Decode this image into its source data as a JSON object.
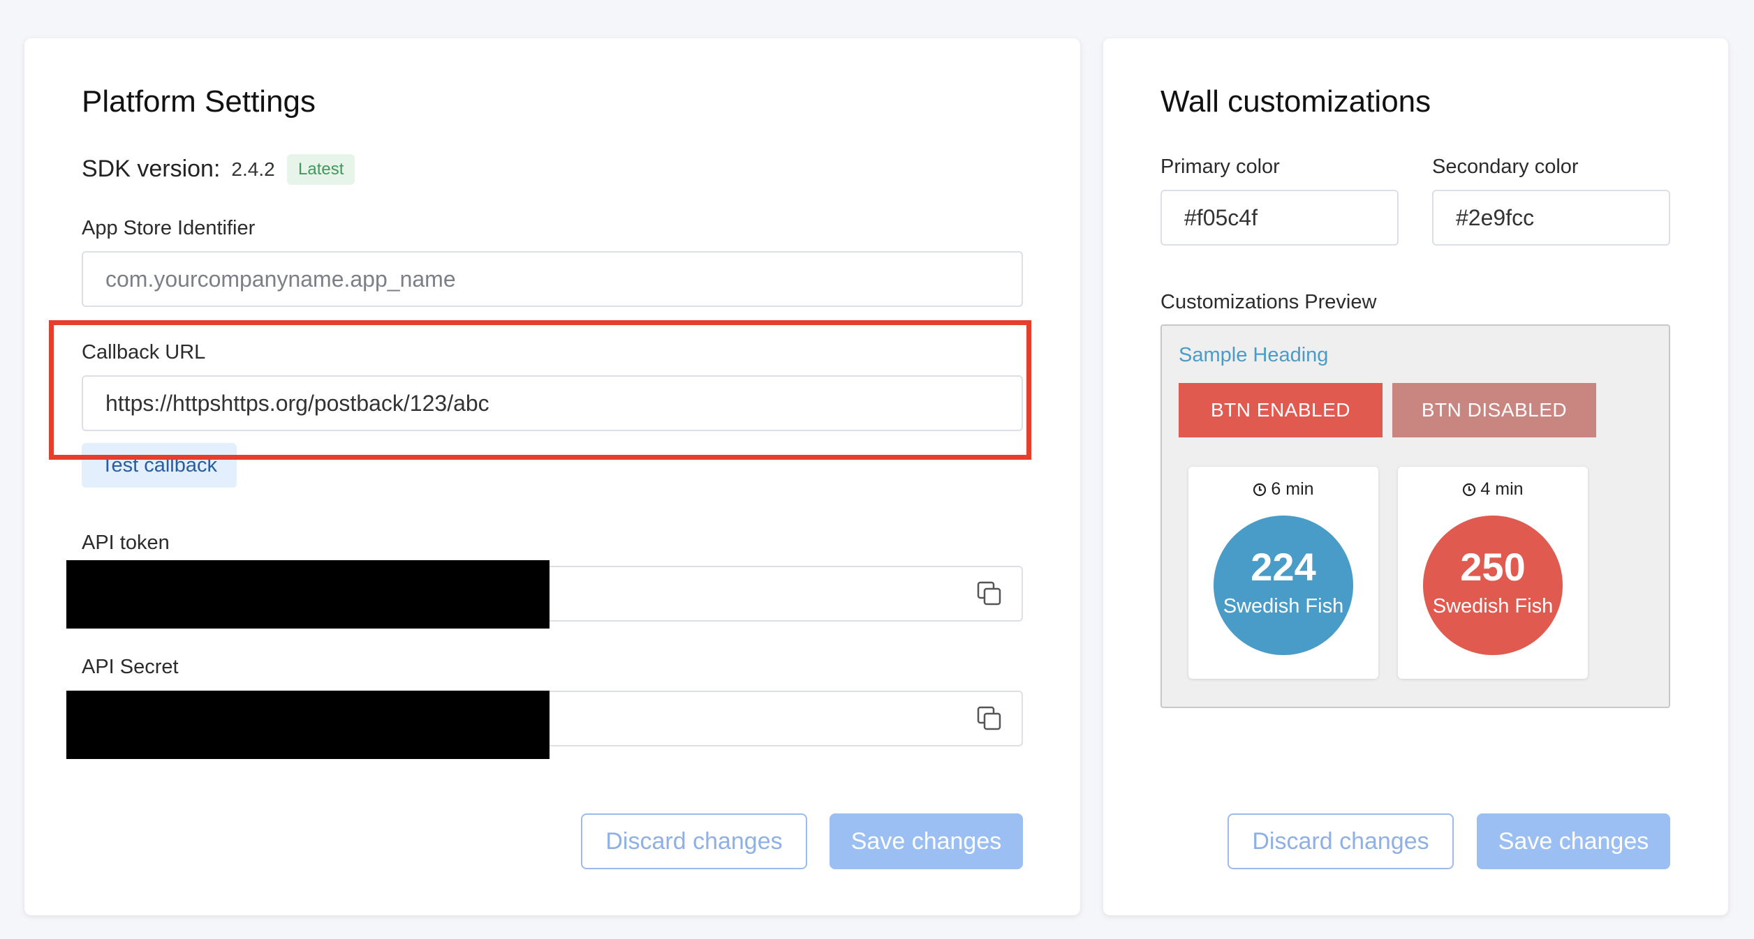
{
  "platform": {
    "title": "Platform Settings",
    "sdk_label": "SDK version:",
    "sdk_version": "2.4.2",
    "sdk_badge": "Latest",
    "app_store_label": "App Store Identifier",
    "app_store_placeholder": "com.yourcompanyname.app_name",
    "callback_label": "Callback URL",
    "callback_value": "https://httpshttps.org/postback/123/abc",
    "test_callback_label": "Test callback",
    "api_token_label": "API token",
    "api_secret_label": "API Secret",
    "discard_label": "Discard changes",
    "save_label": "Save changes"
  },
  "wall": {
    "title": "Wall customizations",
    "primary_label": "Primary color",
    "primary_value": "#f05c4f",
    "secondary_label": "Secondary color",
    "secondary_value": "#2e9fcc",
    "preview_label": "Customizations Preview",
    "preview": {
      "heading": "Sample Heading",
      "btn_enabled": "BTN ENABLED",
      "btn_disabled": "BTN DISABLED",
      "offers": [
        {
          "time": "6 min",
          "amount": "224",
          "currency": "Swedish Fish",
          "color": "#4a9cc8"
        },
        {
          "time": "4 min",
          "amount": "250",
          "currency": "Swedish Fish",
          "color": "#e05a4f"
        }
      ]
    },
    "discard_label": "Discard changes",
    "save_label": "Save changes"
  },
  "colors": {
    "highlight": "#e53e2a",
    "btn_enabled": "#e05a4f",
    "btn_disabled": "#c98680",
    "preview_heading": "#4a9cc8"
  },
  "icons": {
    "copy": "copy-icon",
    "clock": "clock-icon"
  }
}
